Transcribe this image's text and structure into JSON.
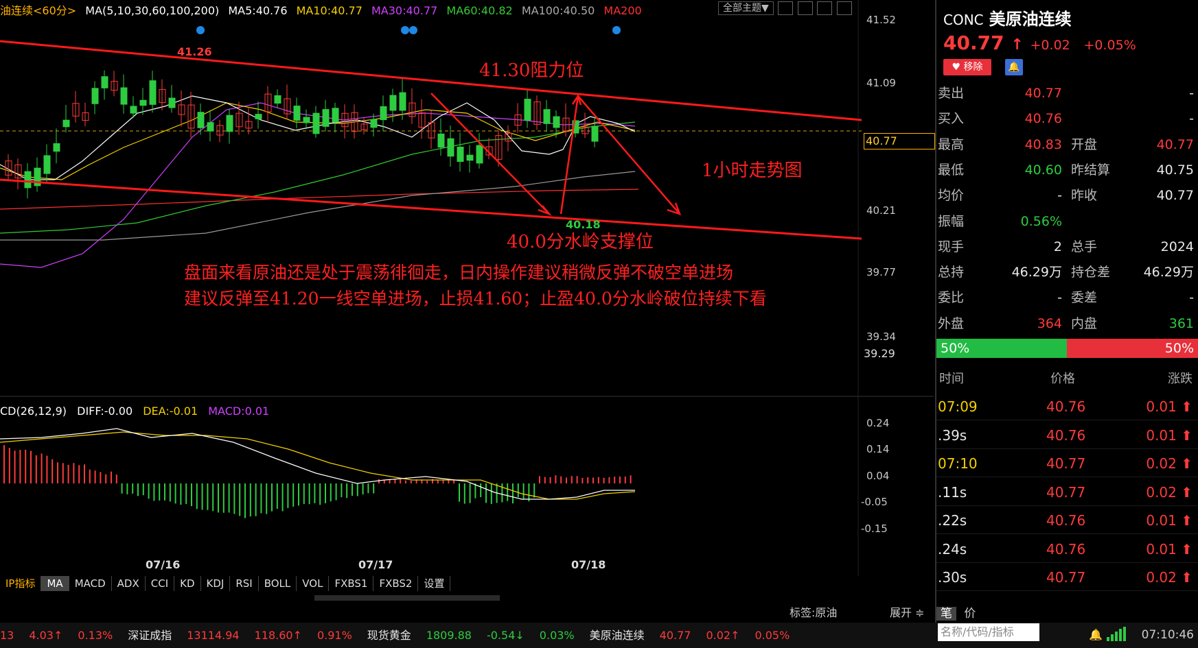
{
  "legend": {
    "symbol": "油连续<60分>",
    "ma_params": "MA(5,10,30,60,100,200)",
    "ma5": "MA5:40.76",
    "ma10": "MA10:40.77",
    "ma30": "MA30:40.77",
    "ma60": "MA60:40.82",
    "ma100": "MA100:40.50",
    "ma200": "MA200",
    "theme_btn": "全部主题▼"
  },
  "colors": {
    "ma5": "#ffffff",
    "ma10": "#f5d000",
    "ma30": "#d040ff",
    "ma60": "#33cc33",
    "ma100": "#aaaaaa",
    "ma200": "#ff3030",
    "up": "#ff3b3b",
    "down": "#2ecc40"
  },
  "yaxis": {
    "t1": "41.52",
    "t2": "41.09",
    "t3": "40.21",
    "t4": "39.77",
    "t5": "39.34",
    "current": "40.77",
    "low_mark": "39.29"
  },
  "annotations": {
    "high_label": "41.26",
    "low_label": "40.18",
    "resistance": "41.30阻力位",
    "timeframe": "1小时走势图",
    "support": "40.0分水岭支撑位",
    "advice1": "盘面来看原油还是处于震荡徘徊走，日内操作建议稍微反弹不破空单进场",
    "advice2": "建议反弹至41.20一线空单进场，止损41.60；止盈40.0分水岭破位持续下看"
  },
  "macd": {
    "label": "CD(26,12,9)",
    "diff": "DIFF:-0.00",
    "dea": "DEA:-0.01",
    "macd": "MACD:0.01",
    "t1": "0.24",
    "t2": "0.14",
    "t3": "0.04",
    "t4": "-0.05",
    "t5": "-0.15"
  },
  "xaxis": {
    "d1": "07/16",
    "d2": "07/17",
    "d3": "07/18"
  },
  "tabs": [
    "IP指标",
    "MA",
    "MACD",
    "ADX",
    "CCI",
    "KD",
    "KDJ",
    "RSI",
    "BOLL",
    "VOL",
    "FXBS1",
    "FXBS2",
    "设置"
  ],
  "tag_label": "标签:原油",
  "expand": "展开 ≑",
  "ticker": [
    {
      "text": "13",
      "cls": "red"
    },
    {
      "text": "4.03↑",
      "cls": "red"
    },
    {
      "text": "0.13%",
      "cls": "red"
    },
    {
      "text": "深证成指",
      "cls": "white"
    },
    {
      "text": "13114.94",
      "cls": "red"
    },
    {
      "text": "118.60↑",
      "cls": "red"
    },
    {
      "text": "0.91%",
      "cls": "red"
    },
    {
      "text": "现货黄金",
      "cls": "white"
    },
    {
      "text": "1809.88",
      "cls": "green"
    },
    {
      "text": "-0.54↓",
      "cls": "green"
    },
    {
      "text": "0.03%",
      "cls": "green"
    },
    {
      "text": "美原油连续",
      "cls": "white"
    },
    {
      "text": "40.77",
      "cls": "red"
    },
    {
      "text": "0.02↑",
      "cls": "red"
    },
    {
      "text": "0.05%",
      "cls": "red"
    }
  ],
  "panel": {
    "code": "CONC",
    "name": "美原油连续",
    "price": "40.77",
    "change": "+0.02",
    "pct": "+0.05%",
    "fav_btn": "♥ 移除",
    "rows": [
      {
        "k": "卖出",
        "v1": "40.77",
        "c1": "red",
        "k2": "",
        "v2": "-",
        "c2": "white"
      },
      {
        "k": "买入",
        "v1": "40.76",
        "c1": "red",
        "k2": "",
        "v2": "-",
        "c2": "white"
      },
      {
        "k": "最高",
        "v1": "40.83",
        "c1": "red",
        "k2": "开盘",
        "v2": "40.77",
        "c2": "red"
      },
      {
        "k": "最低",
        "v1": "40.60",
        "c1": "green",
        "k2": "昨结算",
        "v2": "40.75",
        "c2": "white"
      },
      {
        "k": "均价",
        "v1": "-",
        "c1": "white",
        "k2": "昨收",
        "v2": "40.77",
        "c2": "white"
      },
      {
        "k": "振幅",
        "v1": "0.56%",
        "c1": "green",
        "k2": "",
        "v2": "",
        "c2": "white"
      },
      {
        "k": "现手",
        "v1": "2",
        "c1": "white",
        "k2": "总手",
        "v2": "2024",
        "c2": "white"
      },
      {
        "k": "总持",
        "v1": "46.29万",
        "c1": "white",
        "k2": "持仓差",
        "v2": "46.29万",
        "c2": "white"
      },
      {
        "k": "委比",
        "v1": "-",
        "c1": "white",
        "k2": "委差",
        "v2": "-",
        "c2": "white"
      },
      {
        "k": "外盘",
        "v1": "364",
        "c1": "red",
        "k2": "内盘",
        "v2": "361",
        "c2": "green"
      }
    ],
    "buy_ratio": "50%",
    "sell_ratio": "50%",
    "trades_head": {
      "time": "时间",
      "price": "价格",
      "change": "涨跌"
    },
    "trades": [
      {
        "t": "07:09",
        "tc": "yellow",
        "p": "40.76",
        "c": "0.01 ⬆"
      },
      {
        "t": ".39s",
        "tc": "white",
        "p": "40.76",
        "c": "0.01 ⬆"
      },
      {
        "t": "07:10",
        "tc": "yellow",
        "p": "40.77",
        "c": "0.02 ⬆"
      },
      {
        "t": ".11s",
        "tc": "white",
        "p": "40.77",
        "c": "0.02 ⬆"
      },
      {
        "t": ".22s",
        "tc": "white",
        "p": "40.76",
        "c": "0.01 ⬆"
      },
      {
        "t": ".24s",
        "tc": "white",
        "p": "40.76",
        "c": "0.01 ⬆"
      },
      {
        "t": ".30s",
        "tc": "white",
        "p": "40.77",
        "c": "0.02 ⬆"
      }
    ],
    "tab_trade": "笔",
    "tab_price": "价",
    "search_placeholder": "名称/代码/指标",
    "clock": "07:10:46"
  }
}
